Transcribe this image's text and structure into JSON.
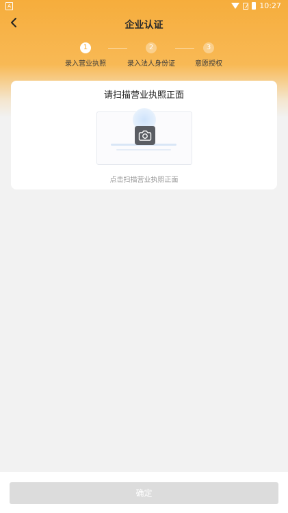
{
  "status_bar": {
    "time": "10:27",
    "left_indicator": "A"
  },
  "header": {
    "title": "企业认证"
  },
  "steps": [
    {
      "number": "1",
      "label": "录入营业执照",
      "active": true
    },
    {
      "number": "2",
      "label": "录入法人身份证",
      "active": false
    },
    {
      "number": "3",
      "label": "意愿授权",
      "active": false
    }
  ],
  "card": {
    "title": "请扫描营业执照正面",
    "hint": "点击扫描营业执照正面"
  },
  "footer": {
    "confirm_label": "确定"
  },
  "colors": {
    "accent": "#f5a425",
    "button_disabled": "#dcdcdc"
  },
  "icons": {
    "back": "chevron-left-icon",
    "camera": "camera-icon",
    "wifi": "wifi-icon",
    "sim": "no-sim-icon",
    "battery": "battery-icon"
  }
}
